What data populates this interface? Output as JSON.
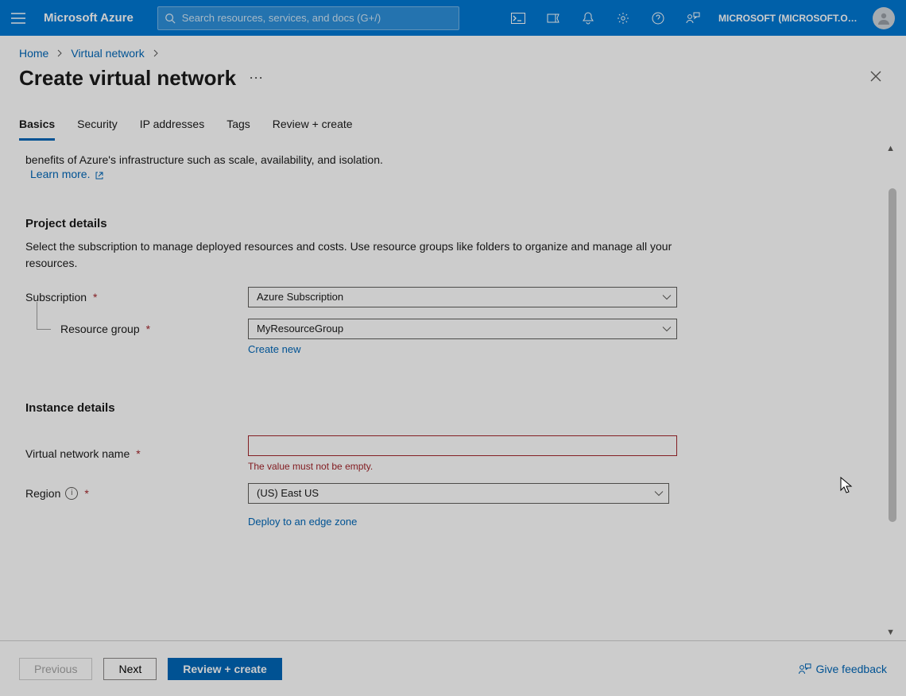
{
  "brand": "Microsoft Azure",
  "search": {
    "placeholder": "Search resources, services, and docs (G+/)"
  },
  "tenant": "MICROSOFT (MICROSOFT.ONMI…",
  "breadcrumb": {
    "home": "Home",
    "vnet": "Virtual network"
  },
  "page": {
    "title": "Create virtual network"
  },
  "tabs": {
    "basics": "Basics",
    "security": "Security",
    "ip": "IP addresses",
    "tags": "Tags",
    "review": "Review + create"
  },
  "intro": {
    "tail": "benefits of Azure's infrastructure such as scale, availability, and isolation.",
    "learn": "Learn more."
  },
  "project": {
    "title": "Project details",
    "sub": "Select the subscription to manage deployed resources and costs. Use resource groups like folders to organize and manage all your resources.",
    "subscription_label": "Subscription",
    "subscription_value": "Azure Subscription",
    "rg_label": "Resource group",
    "rg_value": "MyResourceGroup",
    "create_new": "Create new"
  },
  "instance": {
    "title": "Instance details",
    "name_label": "Virtual network name",
    "name_value": "",
    "name_error": "The value must not be empty.",
    "region_label": "Region",
    "region_value": "(US) East US",
    "edge_link": "Deploy to an edge zone"
  },
  "footer": {
    "prev": "Previous",
    "next": "Next",
    "review": "Review + create",
    "feedback": "Give feedback"
  }
}
